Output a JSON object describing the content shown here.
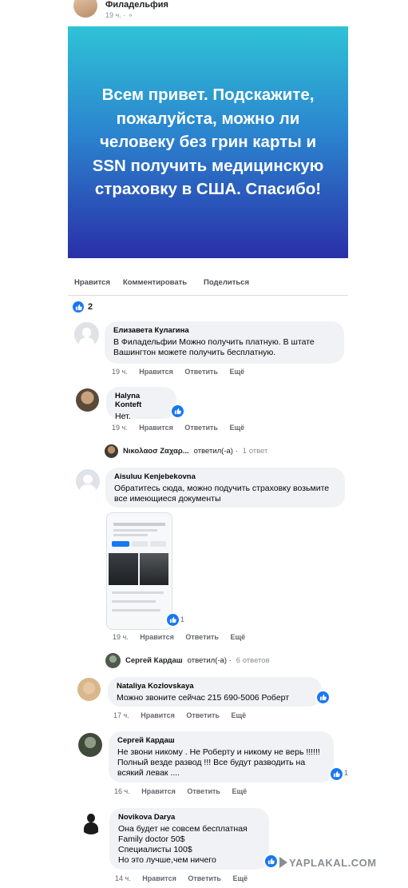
{
  "post": {
    "location": "Филадельфия",
    "time": "19 ч. · ⚬",
    "image_text": "Всем привет. Подскажите, пожалуйста, можно ли человеку без грин карты и SSN получить медицинскую страховку в США. Спасибо!",
    "gradient": [
      "#2ec3d6",
      "#2a2fa8"
    ]
  },
  "actions": {
    "like": "Нравится",
    "comment": "Комментировать",
    "share": "Поделиться"
  },
  "reactions": {
    "count": "2"
  },
  "comments": [
    {
      "name": "Елизавета Кулагина",
      "text": "В Филадельфии Можно получить платную. В штате Вашингтон можете получить бесплатную.",
      "time": "19 ч.",
      "like": "Нравится",
      "reply": "Ответить",
      "more": "Ещё"
    },
    {
      "name": "Halyna Konteft",
      "text": "Нет.",
      "time": "19 ч.",
      "like": "Нравится",
      "reply": "Ответить",
      "more": "Ещё"
    },
    {
      "name": "Aisuluu Kenjebekovna",
      "text": "Обратитесь сюда, можно подучить страховку возьмите все имеющиеся документы",
      "time": "19 ч.",
      "like": "Нравится",
      "reply": "Ответить",
      "more": "Ещё",
      "badge": "1"
    },
    {
      "name": "Nataliya Kozlovskaya",
      "text": "Можно звоните сейчас 215 690-5006 Роберт",
      "time": "17 ч.",
      "like": "Нравится",
      "reply": "Ответить",
      "more": "Ещё"
    },
    {
      "name": "Сергей Кардаш",
      "text": "Не звони никому . Не Роберту и никому не верь !!!!!! Полный везде развод !!! Все будут разводить на всякий левак ....",
      "time": "16 ч.",
      "like": "Нравится",
      "reply": "Ответить",
      "more": "Ещё",
      "badge": "1"
    },
    {
      "name": "Novikova Darya",
      "text": "Она будет не совсем бесплатная\nFamily doctor 50$\nСпециалисты 100$\nНо это лучше,чем ничего",
      "time": "14 ч.",
      "like": "Нравится",
      "reply": "Ответить",
      "more": "Ещё"
    }
  ],
  "replies": [
    {
      "name": "Νικολαοσ Ζαχαρ...",
      "action": "ответил(-а) ·",
      "count": "1 ответ"
    },
    {
      "name": "Сергей Кардаш",
      "action": "ответил(-а) ·",
      "count": "6 ответов"
    }
  ],
  "watermark": "YAPLAKAL.COM",
  "icons": {
    "like": "thumbs-up-icon",
    "default_avatar": "person-silhouette-icon"
  }
}
